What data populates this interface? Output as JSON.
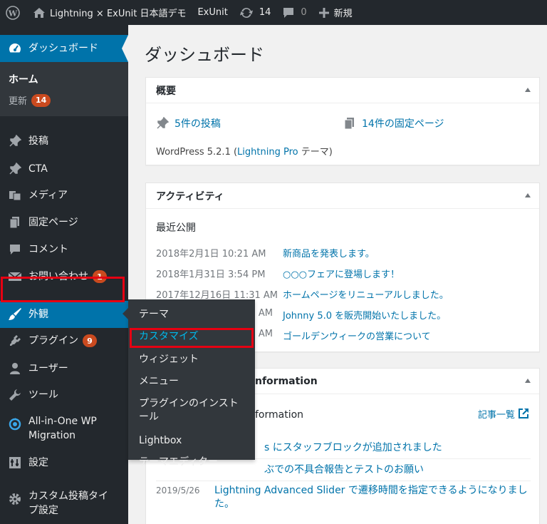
{
  "adminbar": {
    "site_name": "Lightning × ExUnit 日本語デモ",
    "exunit": "ExUnit",
    "updates_count": "14",
    "comments_count": "0",
    "new_label": "新規"
  },
  "sidebar": {
    "dashboard": "ダッシュボード",
    "home": "ホーム",
    "updates": "更新",
    "updates_badge": "14",
    "items": [
      {
        "label": "投稿",
        "icon": "pin-icon"
      },
      {
        "label": "CTA",
        "icon": "pin-icon"
      },
      {
        "label": "メディア",
        "icon": "media-icon"
      },
      {
        "label": "固定ページ",
        "icon": "page-icon"
      },
      {
        "label": "コメント",
        "icon": "comment-icon"
      },
      {
        "label": "お問い合わせ",
        "icon": "mail-icon",
        "badge": "1"
      },
      {
        "label": "外観",
        "icon": "brush-icon"
      },
      {
        "label": "プラグイン",
        "icon": "plugin-icon",
        "badge": "9"
      },
      {
        "label": "ユーザー",
        "icon": "user-icon"
      },
      {
        "label": "ツール",
        "icon": "wrench-icon"
      },
      {
        "label_line1": "All-in-One WP",
        "label_line2": "Migration",
        "icon": "migration-icon"
      },
      {
        "label": "設定",
        "icon": "settings-icon"
      },
      {
        "label_line1": "カスタム投稿タイ",
        "label_line2": "プ設定",
        "icon": "gear-icon"
      }
    ]
  },
  "flyout": {
    "items": [
      "テーマ",
      "カスタマイズ",
      "ウィジェット",
      "メニュー",
      "プラグインのインスト",
      "ール",
      "Lightbox",
      "テーマエディター"
    ]
  },
  "main": {
    "title": "ダッシュボード",
    "glance": {
      "title": "概要",
      "posts": "5件の投稿",
      "pages": "14件の固定ページ",
      "version_prefix": "WordPress 5.2.1 (",
      "theme_link": "Lightning Pro",
      "version_suffix": " テーマ)"
    },
    "activity": {
      "title": "アクティビティ",
      "heading": "最近公開",
      "rows": [
        {
          "date": "2018年2月1日 10:21 AM",
          "title": "新商品を発表します。"
        },
        {
          "date": "2018年1月31日 3:54 PM",
          "title": "○○○フェアに登場します！"
        },
        {
          "date": "2017年12月16日 11:31 AM",
          "title": "ホームページをリニューアルしました。"
        },
        {
          "date": "AM",
          "title": "Johnny 5.0 を販売開始いたしました。"
        },
        {
          "date": "AM",
          "title": "ゴールデンウィークの営業について"
        }
      ]
    },
    "info": {
      "title_visible": "nformation",
      "subtitle_visible": "formation",
      "list_link": "記事一覧",
      "rows": [
        {
          "date": "",
          "title": "s にスタッフブロックが追加されました"
        },
        {
          "date": "",
          "title": "ぶでの不具合報告とテストのお願い"
        },
        {
          "date": "2019/5/26",
          "title_line1": "Lightning Advanced Slider で遷移時間を指定できるようになりまし",
          "title_line2": "た。"
        }
      ]
    }
  }
}
